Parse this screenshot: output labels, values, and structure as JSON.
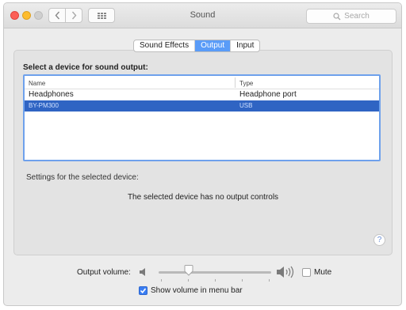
{
  "window": {
    "title": "Sound"
  },
  "toolbar": {
    "search_placeholder": "Search"
  },
  "tabs": [
    {
      "label": "Sound Effects",
      "active": false
    },
    {
      "label": "Output",
      "active": true
    },
    {
      "label": "Input",
      "active": false
    }
  ],
  "output": {
    "heading": "Select a device for sound output:",
    "columns": [
      "Name",
      "Type"
    ],
    "devices": [
      {
        "name": "Headphones",
        "type": "Headphone port",
        "selected": false
      },
      {
        "name": "BY-PM300",
        "type": "USB",
        "selected": true
      }
    ],
    "settings_label": "Settings for the selected device:",
    "no_controls_text": "The selected device has no output controls"
  },
  "help": {
    "label": "?"
  },
  "volume": {
    "label": "Output volume:",
    "level": 0.27,
    "mute_label": "Mute",
    "muted": false,
    "show_in_menubar_label": "Show volume in menu bar",
    "show_in_menubar": true
  },
  "colors": {
    "accent": "#2f64c3",
    "tab_active": "#5a9cf8",
    "close": "#fc5f57",
    "minimize": "#fdbc2e"
  }
}
